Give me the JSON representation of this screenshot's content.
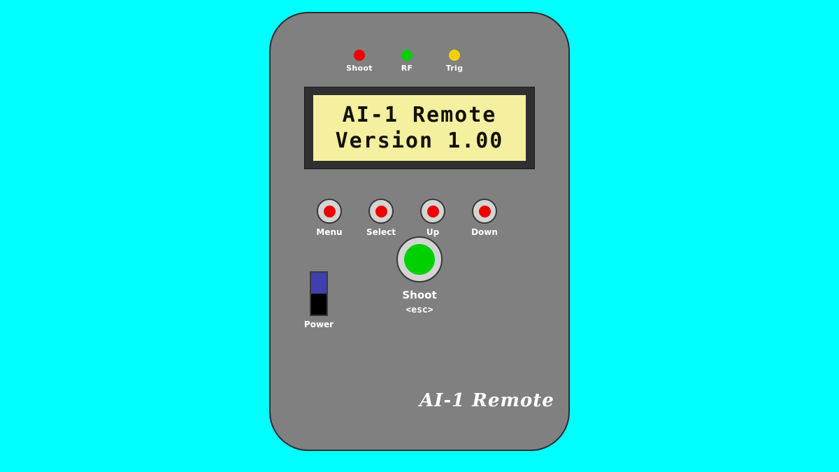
{
  "background_color": "#00ffff",
  "device": {
    "body_color": "#808080",
    "outline_color": "#2b2b33",
    "brand_text": "AI-1 Remote"
  },
  "leds": [
    {
      "name": "shoot-led",
      "label": "Shoot",
      "color": "#ee0000"
    },
    {
      "name": "rf-led",
      "label": "RF",
      "color": "#00d000"
    },
    {
      "name": "trig-led",
      "label": "Trig",
      "color": "#f2d000"
    }
  ],
  "lcd": {
    "bezel_color": "#303030",
    "screen_color": "#f5efa0",
    "text_color": "#121208",
    "line1": "AI-1 Remote",
    "line2": "Version 1.00"
  },
  "buttons": [
    {
      "name": "menu-button",
      "label": "Menu",
      "cap_color": "#ee0000"
    },
    {
      "name": "select-button",
      "label": "Select",
      "cap_color": "#ee0000"
    },
    {
      "name": "up-button",
      "label": "Up",
      "cap_color": "#ee0000"
    },
    {
      "name": "down-button",
      "label": "Down",
      "cap_color": "#ee0000"
    }
  ],
  "shoot_button": {
    "label": "Shoot",
    "sublabel": "<esc>",
    "cap_color": "#00d000",
    "ring_color": "#d4d4d4"
  },
  "power_switch": {
    "label": "Power",
    "knob_color": "#3f3fb0",
    "slot_color": "#000000",
    "position": "up"
  }
}
